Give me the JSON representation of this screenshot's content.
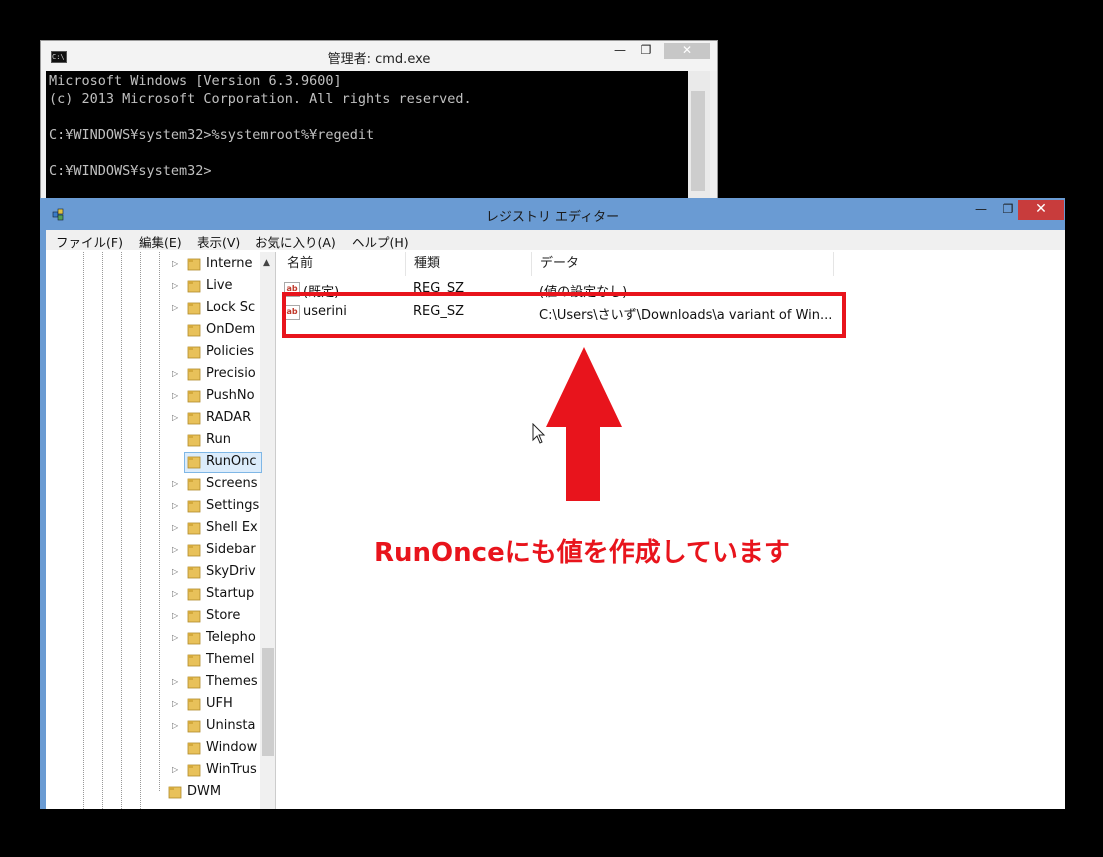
{
  "cmd": {
    "title": "管理者: cmd.exe",
    "icon": "cmd-icon",
    "console_lines": [
      "Microsoft Windows [Version 6.3.9600]",
      "(c) 2013 Microsoft Corporation. All rights reserved.",
      "",
      "C:¥WINDOWS¥system32>%systemroot%¥regedit",
      "",
      "C:¥WINDOWS¥system32>"
    ]
  },
  "regedit": {
    "title": "レジストリ エディター",
    "menu": [
      "ファイル(F)",
      "編集(E)",
      "表示(V)",
      "お気に入り(A)",
      "ヘルプ(H)"
    ],
    "tree_items": [
      {
        "label": "Interne",
        "expandable": true
      },
      {
        "label": "Live",
        "expandable": true
      },
      {
        "label": "Lock Sc",
        "expandable": true
      },
      {
        "label": "OnDem",
        "expandable": false
      },
      {
        "label": "Policies",
        "expandable": false
      },
      {
        "label": "Precisio",
        "expandable": true
      },
      {
        "label": "PushNo",
        "expandable": true
      },
      {
        "label": "RADAR",
        "expandable": true
      },
      {
        "label": "Run",
        "expandable": false
      },
      {
        "label": "RunOnc",
        "expandable": false,
        "selected": true
      },
      {
        "label": "Screens",
        "expandable": true
      },
      {
        "label": "Settings",
        "expandable": true
      },
      {
        "label": "Shell Ex",
        "expandable": true
      },
      {
        "label": "Sidebar",
        "expandable": true
      },
      {
        "label": "SkyDriv",
        "expandable": true
      },
      {
        "label": "Startup",
        "expandable": true
      },
      {
        "label": "Store",
        "expandable": true
      },
      {
        "label": "Telepho",
        "expandable": true
      },
      {
        "label": "Themel",
        "expandable": false
      },
      {
        "label": "Themes",
        "expandable": true
      },
      {
        "label": "UFH",
        "expandable": true
      },
      {
        "label": "Uninsta",
        "expandable": true
      },
      {
        "label": "Window",
        "expandable": false
      },
      {
        "label": "WinTrus",
        "expandable": true
      }
    ],
    "tree_parent_item": "DWM",
    "columns": [
      "名前",
      "種類",
      "データ"
    ],
    "rows": [
      {
        "name": "(既定)",
        "type": "REG_SZ",
        "data": "(値の設定なし)"
      },
      {
        "name": "userini",
        "type": "REG_SZ",
        "data": "C:\\Users\\さいず\\Downloads\\a variant of Win..."
      }
    ]
  },
  "annotation": {
    "text": "RunOnceにも値を作成しています",
    "color": "#e8141c"
  }
}
